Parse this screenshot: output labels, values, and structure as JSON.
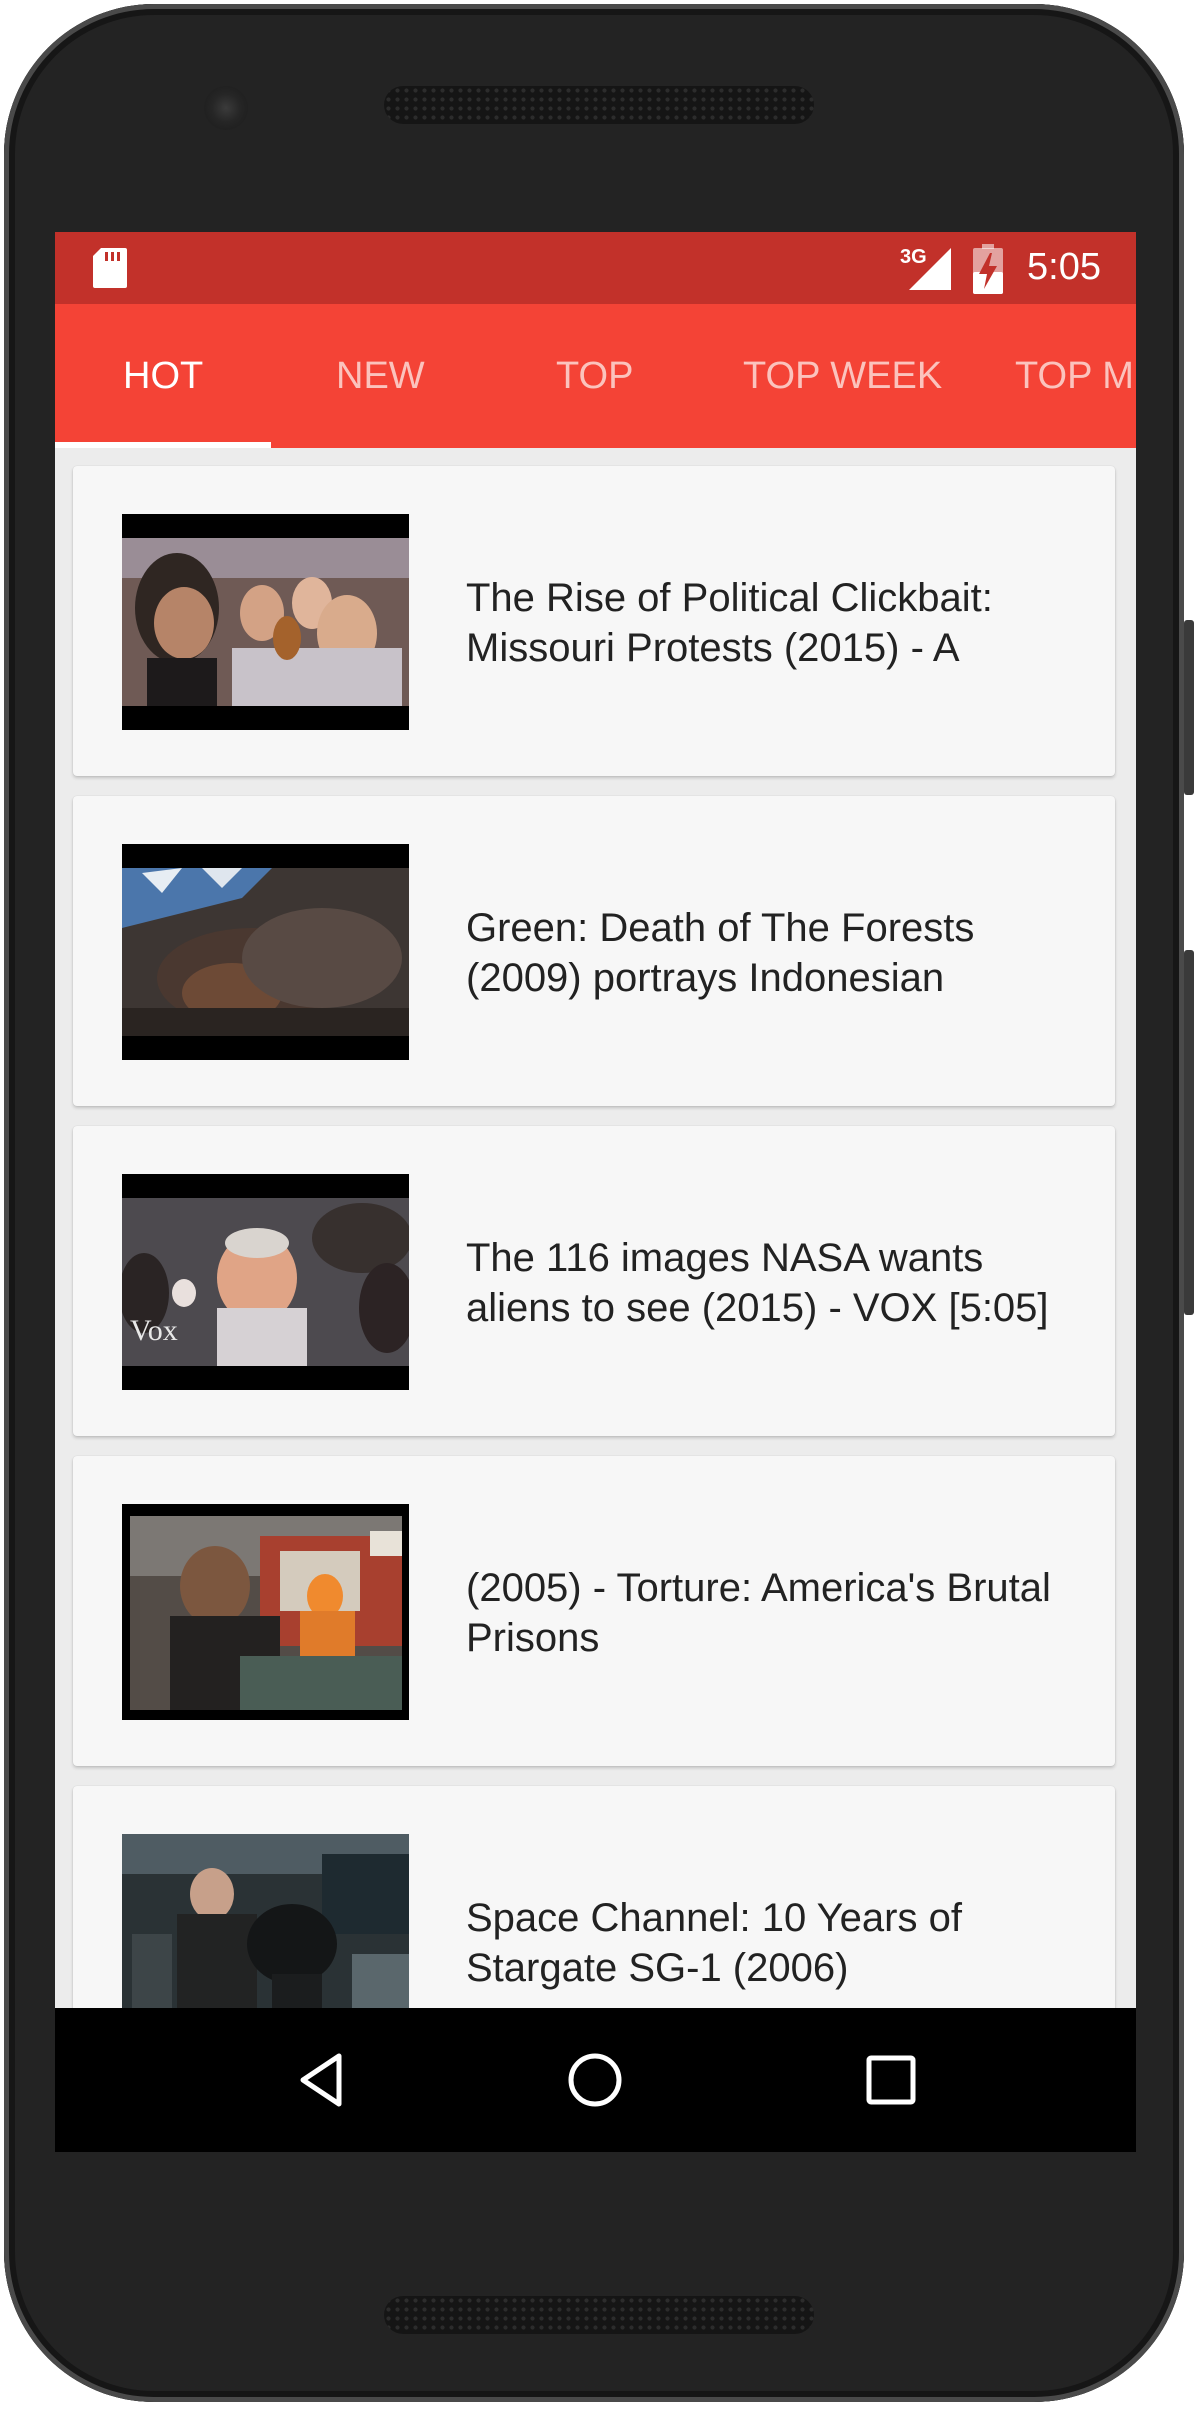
{
  "status_bar": {
    "network": "3G",
    "time": "5:05"
  },
  "tabs": [
    {
      "label": "HOT",
      "active": true
    },
    {
      "label": "NEW",
      "active": false
    },
    {
      "label": "TOP",
      "active": false
    },
    {
      "label": "TOP WEEK",
      "active": false
    },
    {
      "label": "TOP M",
      "active": false
    }
  ],
  "videos": [
    {
      "title": "The Rise of Political Clickbait: Missouri Protests (2015) - A"
    },
    {
      "title": "Green: Death of The Forests (2009) portrays Indonesian"
    },
    {
      "title": "The 116 images NASA wants aliens to see (2015) - VOX [5:05]"
    },
    {
      "title": "(2005) - Torture: America's Brutal Prisons"
    },
    {
      "title": "Space Channel: 10 Years of Stargate SG-1 (2006)"
    }
  ],
  "thumbnail_overlays": {
    "video_3": "Vox"
  },
  "colors": {
    "status_bar": "#c2312a",
    "tab_bar": "#f44336",
    "tab_active_text": "#ffffff",
    "tab_inactive_text": "#fbc3bd",
    "card_bg": "#f7f7f7",
    "list_bg": "#ececec"
  },
  "icons": {
    "status": [
      "sd-card-icon",
      "signal-3g-icon",
      "battery-charging-icon"
    ],
    "navigation": [
      "back-icon",
      "home-icon",
      "recents-icon"
    ]
  }
}
